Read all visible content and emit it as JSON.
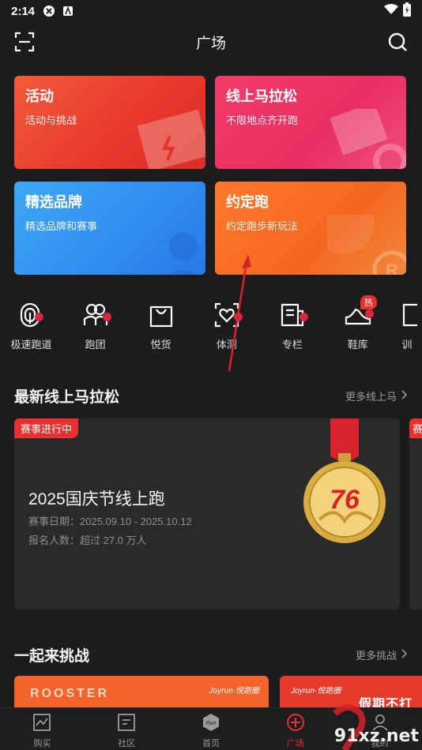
{
  "status_bar": {
    "time": "2:14"
  },
  "header": {
    "title": "广场"
  },
  "cards": [
    {
      "title": "活动",
      "subtitle": "活动与挑战"
    },
    {
      "title": "线上马拉松",
      "subtitle": "不限地点齐开跑"
    },
    {
      "title": "精选品牌",
      "subtitle": "精选品牌和赛事"
    },
    {
      "title": "约定跑",
      "subtitle": "约定跑步新玩法"
    }
  ],
  "quick_nav": [
    {
      "label": "极速跑道",
      "icon": "track-icon"
    },
    {
      "label": "跑团",
      "icon": "team-icon"
    },
    {
      "label": "悦货",
      "icon": "shopping-bag-icon"
    },
    {
      "label": "体测",
      "icon": "heart-test-icon"
    },
    {
      "label": "专栏",
      "icon": "column-icon"
    },
    {
      "label": "鞋库",
      "icon": "shoe-icon",
      "badge": "热"
    },
    {
      "label": "训",
      "icon": "training-icon"
    }
  ],
  "section_marathon": {
    "title": "最新线上马拉松",
    "more": "更多线上马"
  },
  "race": {
    "badge": "赛事进行中",
    "title": "2025国庆节线上跑",
    "date": "赛事日期：2025.09.10 - 2025.10.12",
    "count": "报名人数：超过 27.0 万人",
    "medal_text": "76"
  },
  "race_next": {
    "badge": "赛"
  },
  "section_challenge": {
    "title": "一起来挑战",
    "more": "更多挑战"
  },
  "challenges": [
    {
      "brand": "Joyrun·悦跑圈",
      "text": "ROOSTER"
    },
    {
      "brand": "Joyrun·悦跑圈",
      "text": "假期不打"
    }
  ],
  "tab_bar": [
    {
      "label": "购买",
      "icon": "chart-icon"
    },
    {
      "label": "社区",
      "icon": "community-icon"
    },
    {
      "label": "首页",
      "icon": "home-badge-icon"
    },
    {
      "label": "广场",
      "icon": "plaza-icon",
      "active": true
    },
    {
      "label": "我的",
      "icon": "profile-icon"
    }
  ],
  "watermark": {
    "text": "91xz.net"
  },
  "colors": {
    "accent": "#e8302c",
    "background": "#1c1c1e"
  }
}
